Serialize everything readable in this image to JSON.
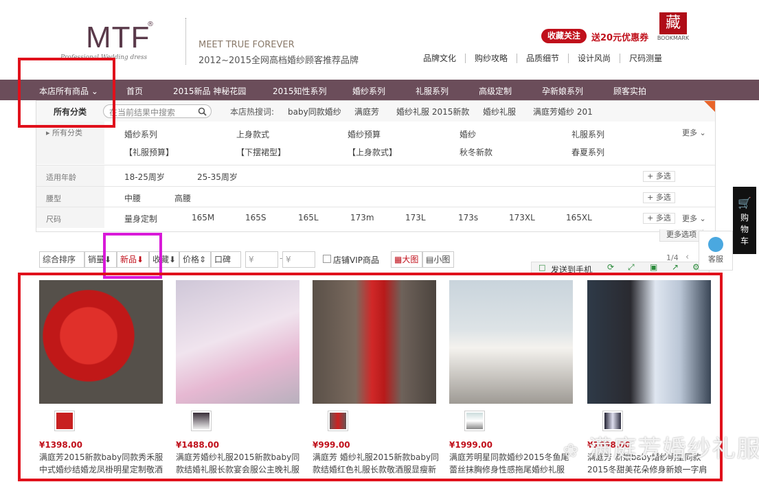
{
  "brand": {
    "logo": "MTF",
    "logo_reg": "®",
    "logo_tagline": "Professional Wedding dress",
    "slogan_en": "MEET TRUE FOREVER",
    "slogan_cn": "2012~2015全网高档婚纱顾客推荐品牌",
    "favorite_label": "收藏关注",
    "coupon_text": "送20元优惠券",
    "bookmark_char": "藏",
    "bookmark_text": "BOOKMARK"
  },
  "top_links": [
    "品牌文化",
    "购纱攻略",
    "品质细节",
    "设计风尚",
    "尺码测量"
  ],
  "nav": {
    "items": [
      "本店所有商品",
      "首页",
      "2015新品 神秘花园",
      "2015知性系列",
      "婚纱系列",
      "礼服系列",
      "高级定制",
      "孕新娘系列",
      "顾客实拍"
    ]
  },
  "filter": {
    "all_category": "所有分类",
    "search_placeholder": "在当前结果中搜索",
    "hot_label": "本店热搜词:",
    "hot_terms": [
      "baby同款婚纱",
      "满庭芳",
      "婚纱礼服 2015新款",
      "婚纱礼服",
      "满庭芳婚纱 201"
    ],
    "cat_label": "所有分类",
    "categories_row1": [
      "婚纱系列",
      "上身款式",
      "婚纱预算",
      "婚纱",
      "礼服系列"
    ],
    "categories_row2": [
      "【礼服预算】",
      "【下摆裙型】",
      "【上身款式】",
      "秋冬新款",
      "春夏系列"
    ],
    "more_label": "更多",
    "age_label": "适用年龄",
    "age_values": [
      "18-25周岁",
      "25-35周岁"
    ],
    "waist_label": "腰型",
    "waist_values": [
      "中腰",
      "高腰"
    ],
    "size_label": "尺码",
    "size_values": [
      "量身定制",
      "165M",
      "165S",
      "165L",
      "173m",
      "173L",
      "173s",
      "173XL",
      "165XL"
    ],
    "multi_label": "多选",
    "more_options": "更多选项"
  },
  "sort": {
    "composite": "综合排序",
    "sales": "销量",
    "new": "新品",
    "fav": "收藏",
    "price": "价格",
    "word_of_mouth": "口碑",
    "currency": "¥",
    "vip": "店铺VIP商品",
    "big_view": "大图",
    "small_view": "小图",
    "page": "1/4",
    "send_phone": "发送到手机"
  },
  "side": {
    "cart": "购物车",
    "service": "客服"
  },
  "products": [
    {
      "price": "¥1398.00",
      "desc": "满庭芳2015新款baby同款秀禾服中式婚纱结婚龙凤褂明星定制敬酒"
    },
    {
      "price": "¥1488.00",
      "desc": "满庭芳婚纱礼服2015新款baby同款结婚礼服长款宴会服公主晚礼服"
    },
    {
      "price": "¥999.00",
      "desc": "满庭芳 婚纱礼服2015新款baby同款结婚红色礼服长款敬酒服显瘦新"
    },
    {
      "price": "¥1999.00",
      "desc": "满庭芳明星同款婚纱2015冬鱼尾蕾丝抹胸修身性感拖尾婚纱礼服"
    },
    {
      "price": "¥1698.00",
      "desc": "满庭芳 新娘baby婚纱明星同款2015冬甜美花朵修身新娘一字肩"
    }
  ],
  "watermark": "满庭芳婚纱礼服",
  "colors": {
    "nav_bg": "#6b4d5a",
    "accent_red": "#c0101b",
    "highlight_red": "#e0101b",
    "highlight_magenta": "#d81ad8"
  }
}
